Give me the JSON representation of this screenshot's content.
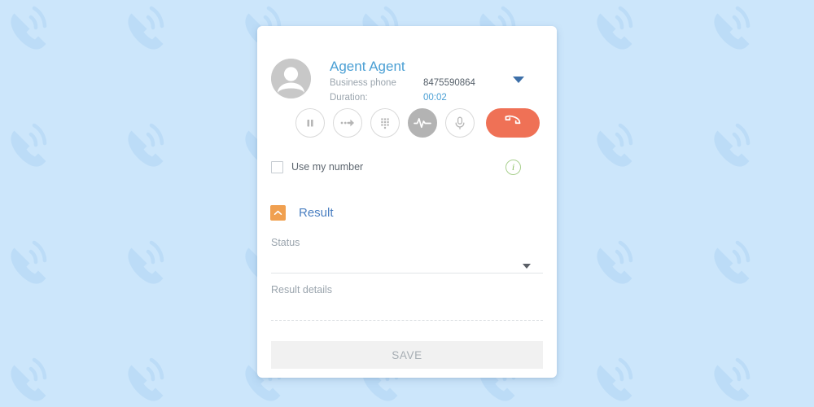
{
  "background": {
    "color": "#cce6fb",
    "pattern_icon": "phone-ringing-icon",
    "pattern_color": "#bcdcf7"
  },
  "card": {
    "background": "#ffffff",
    "header": {
      "avatar": "user-avatar-icon",
      "caller_name": "Agent Agent",
      "dropdown_icon": "chevron-down-icon",
      "details": [
        {
          "label": "Business phone",
          "value": "8475590864",
          "accent": false
        },
        {
          "label": "Duration:",
          "value": "00:02",
          "accent": true
        }
      ]
    },
    "controls": {
      "buttons": [
        {
          "name": "hold-button",
          "icon": "pause-icon",
          "active": false
        },
        {
          "name": "transfer-button",
          "icon": "transfer-arrow-icon",
          "active": false
        },
        {
          "name": "keypad-button",
          "icon": "dialpad-icon",
          "active": false
        },
        {
          "name": "record-button",
          "icon": "waveform-icon",
          "active": true
        },
        {
          "name": "mute-button",
          "icon": "microphone-icon",
          "active": false
        }
      ],
      "hangup": {
        "name": "hangup-button",
        "icon": "phone-hangup-icon",
        "color": "#ef7156"
      }
    },
    "use_my_number": {
      "label": "Use my number",
      "checked": false,
      "info_icon": "info-icon",
      "info_color": "#8cc063"
    },
    "result": {
      "toggle_icon": "chevron-up-icon",
      "toggle_color": "#f0a050",
      "title": "Result",
      "title_color": "#4a7fc1",
      "fields": [
        {
          "label": "Status",
          "value": "",
          "type": "select"
        },
        {
          "label": "Result details",
          "value": "",
          "type": "text"
        }
      ]
    },
    "save_label": "SAVE"
  }
}
